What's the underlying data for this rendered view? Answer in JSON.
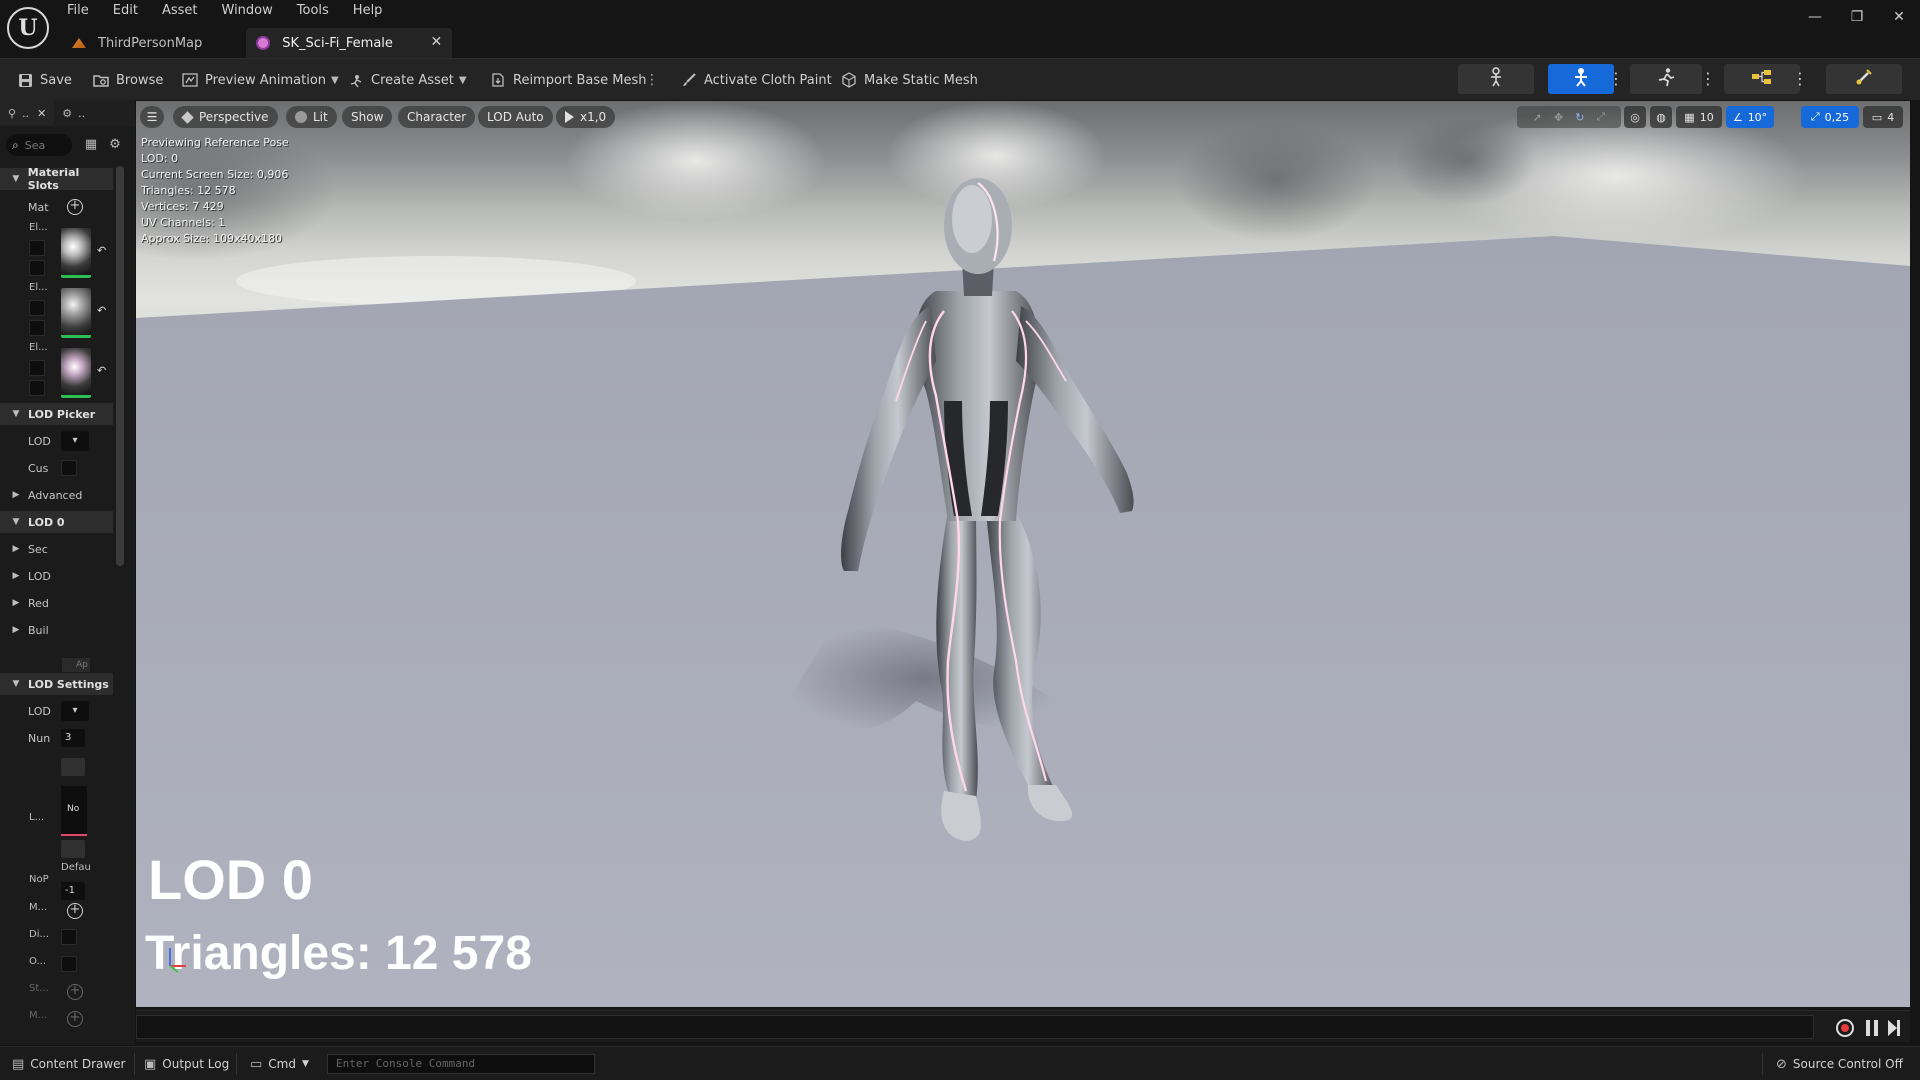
{
  "app": {
    "logo_text": "U",
    "menu": [
      "File",
      "Edit",
      "Asset",
      "Window",
      "Tools",
      "Help"
    ],
    "tabs": [
      {
        "label": "ThirdPersonMap",
        "active": false
      },
      {
        "label": "SK_Sci-Fi_Female",
        "active": true
      }
    ],
    "window_controls": {
      "minimize": "—",
      "restore": "❐",
      "close": "✕"
    }
  },
  "toolbar": {
    "save": "Save",
    "browse": "Browse",
    "preview_animation": "Preview Animation",
    "create_asset": "Create Asset",
    "reimport_base_mesh": "Reimport Base Mesh",
    "activate_cloth_paint": "Activate Cloth Paint",
    "make_static_mesh": "Make Static Mesh",
    "accent_color": "#1669d9"
  },
  "left_panel": {
    "tab1": "..",
    "tab2": "..",
    "search_placeholder": "Sea",
    "rows": {
      "material_slots": "Material Slots",
      "mat": "Mat",
      "el1": "El...",
      "el2": "El...",
      "el3": "El...",
      "lod_picker": "LOD Picker",
      "lod_picker_lod": "LOD",
      "cus": "Cus",
      "advanced": "Advanced",
      "lod0": "LOD 0",
      "sec": "Sec",
      "lod_sub": "LOD",
      "red": "Red",
      "buil": "Buil",
      "ap": "Ap",
      "lod_settings": "LOD Settings",
      "lod_settings_lod": "LOD",
      "num": "Nun",
      "num_value": "3",
      "l_dots": "L...",
      "no_label": "No",
      "defau": "Defau",
      "nop": "NoP",
      "nop_value": "-1",
      "m1": "M...",
      "di": "Di...",
      "o": "O...",
      "st": "St...",
      "m2": "M..."
    }
  },
  "viewport": {
    "perspective": "Perspective",
    "lit": "Lit",
    "show": "Show",
    "character": "Character",
    "lod_auto": "LOD Auto",
    "play_rate": "x1,0",
    "grid_snap": "10",
    "rot_snap": "10°",
    "scale_snap": "0,25",
    "camera_speed": "4",
    "stats": [
      "Previewing Reference Pose",
      "LOD: 0",
      "Current Screen Size: 0,906",
      "Triangles: 12 578",
      "Vertices: 7 429",
      "UV Channels: 1",
      "Approx Size: 109x40x180"
    ],
    "big_lod": "LOD 0",
    "big_triangles": "Triangles: 12 578"
  },
  "statusbar": {
    "content_drawer": "Content Drawer",
    "output_log": "Output Log",
    "cmd": "Cmd",
    "console_placeholder": "Enter Console Command",
    "source_control": "Source Control Off"
  }
}
